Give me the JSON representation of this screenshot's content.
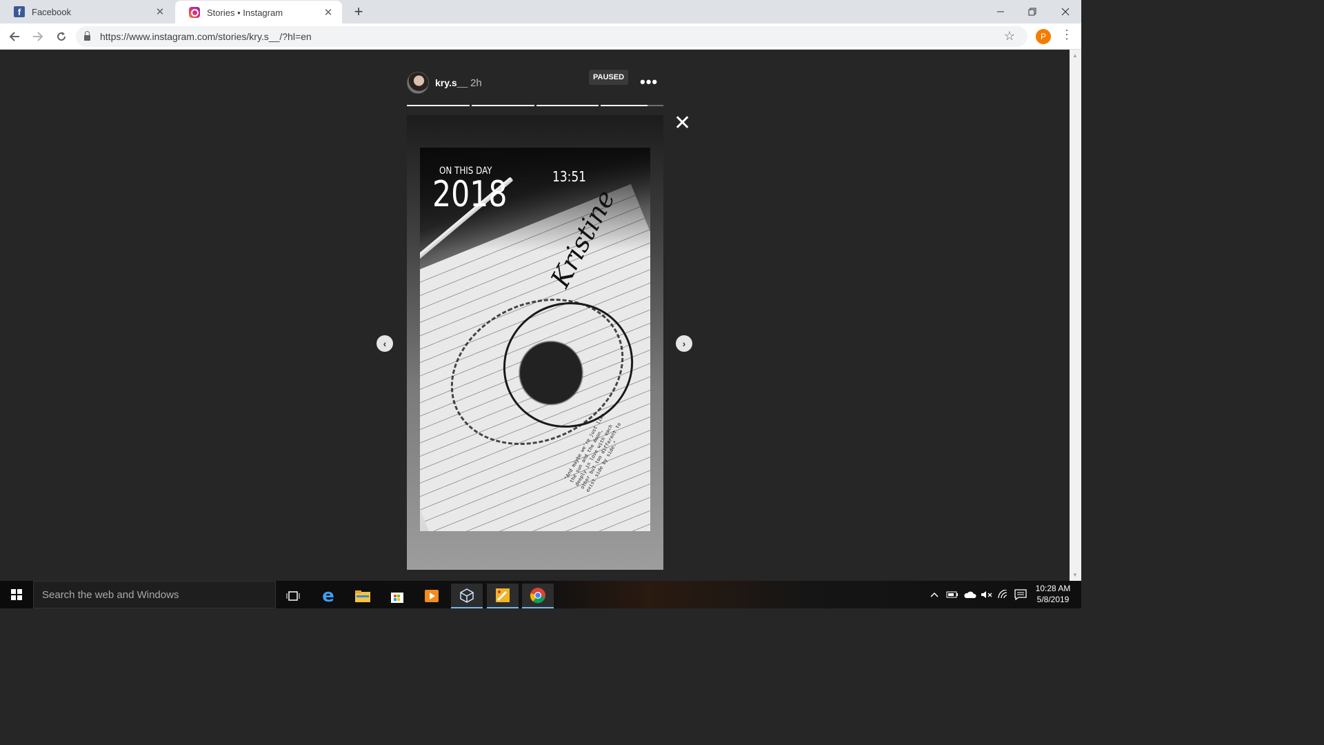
{
  "browser": {
    "tabs": [
      {
        "title": "Facebook",
        "icon": "facebook-icon"
      },
      {
        "title": "Stories • Instagram",
        "icon": "instagram-icon"
      }
    ],
    "new_tab_glyph": "+",
    "url": "https://www.instagram.com/stories/kry.s__/?hl=en",
    "profile_initial": "P"
  },
  "story": {
    "username": "kry.s__",
    "time_ago": "2h",
    "status_badge": "PAUSED",
    "more_glyph": "•••",
    "segments_progress": [
      1.0,
      1.0,
      1.0,
      0.75
    ],
    "overlay": {
      "label": "ON THIS DAY",
      "year": "2018",
      "time": "13:51"
    },
    "handwritten_quote": "\"And maybe we're just like the sun and the moon, deeply in love with each other but too different to exist side by side.\""
  },
  "taskbar": {
    "search_placeholder": "Search the web and Windows",
    "time": "10:28 AM",
    "date": "5/8/2019"
  },
  "colors": {
    "page_background": "#262626",
    "profile_badge": "#f57c00",
    "taskbar_active_underline": "#76b9ed"
  }
}
